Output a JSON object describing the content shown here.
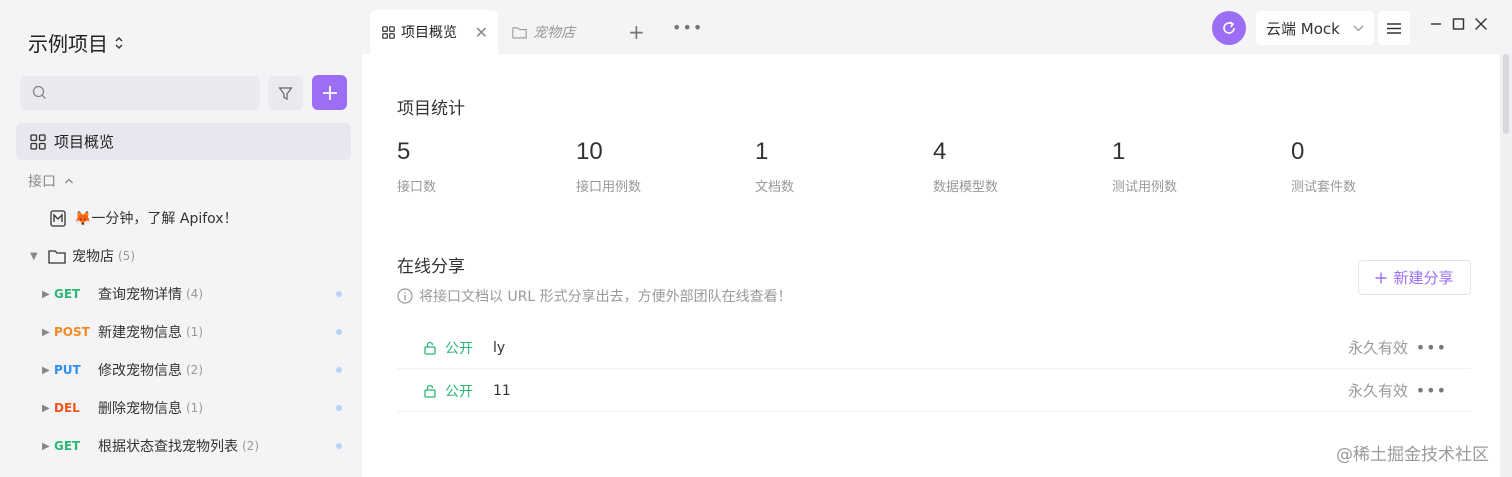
{
  "sidebar": {
    "project_title": "示例项目",
    "search": {
      "placeholder": ""
    },
    "nav_overview": "项目概览",
    "section_label": "接口",
    "intro_doc": "🦊一分钟，了解 Apifox！",
    "folder": {
      "name": "宠物店",
      "count": "(5)"
    },
    "endpoints": [
      {
        "method": "GET",
        "method_color": "#2bb673",
        "name": "查询宠物详情",
        "count": "(4)"
      },
      {
        "method": "POST",
        "method_color": "#f08a24",
        "name": "新建宠物信息",
        "count": "(1)"
      },
      {
        "method": "PUT",
        "method_color": "#2f8ef4",
        "name": "修改宠物信息",
        "count": "(2)"
      },
      {
        "method": "DEL",
        "method_color": "#f5531c",
        "name": "删除宠物信息",
        "count": "(1)"
      },
      {
        "method": "GET",
        "method_color": "#2bb673",
        "name": "根据状态查找宠物列表",
        "count": "(2)"
      }
    ]
  },
  "tabs": {
    "active": "项目概览",
    "second": "宠物店"
  },
  "toolbar": {
    "env_label": "云端 Mock"
  },
  "main": {
    "stats_title": "项目统计",
    "stats": [
      {
        "value": "5",
        "label": "接口数"
      },
      {
        "value": "10",
        "label": "接口用例数"
      },
      {
        "value": "1",
        "label": "文档数"
      },
      {
        "value": "4",
        "label": "数据模型数"
      },
      {
        "value": "1",
        "label": "测试用例数"
      },
      {
        "value": "0",
        "label": "测试套件数"
      }
    ],
    "share_title": "在线分享",
    "share_hint": "将接口文档以 URL 形式分享出去，方便外部团队在线查看！",
    "new_share_label": "新建分享",
    "shares": [
      {
        "visibility": "公开",
        "name": "ly",
        "validity": "永久有效"
      },
      {
        "visibility": "公开",
        "name": "11",
        "validity": "永久有效"
      }
    ]
  },
  "watermark": "@稀土掘金技术社区",
  "colors": {
    "accent": "#9b6ef3",
    "public_green": "#2bb673"
  }
}
